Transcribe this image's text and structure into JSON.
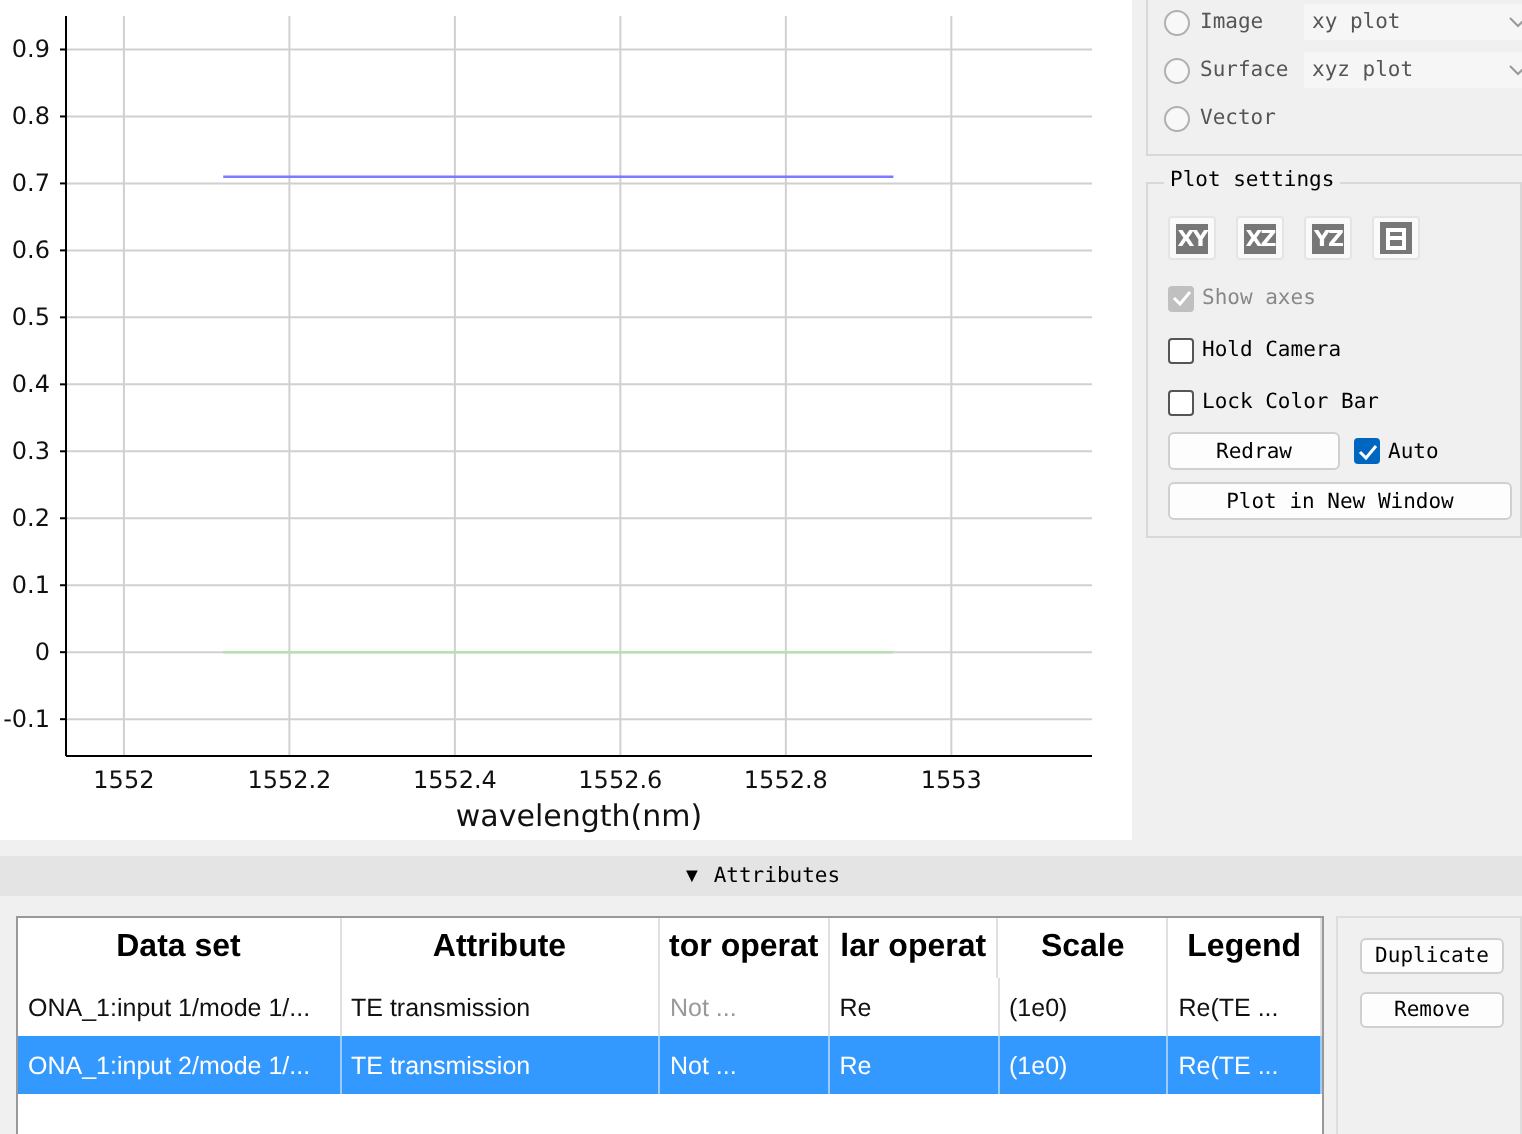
{
  "plot": {
    "chart_data": {
      "type": "line",
      "xlabel": "wavelength(nm)",
      "xlim": [
        1551.93,
        1553.17
      ],
      "ylim": [
        -0.155,
        0.95
      ],
      "xticks": [
        1552,
        {
          "value": 1552.2,
          "label": "1552.2"
        },
        {
          "value": 1552.4,
          "label": "1552.4"
        },
        {
          "value": 1552.6,
          "label": "1552.6"
        },
        {
          "value": 1552.8,
          "label": "1552.8"
        },
        1553
      ],
      "yticks": [
        {
          "value": -0.1,
          "label": "-0.1"
        },
        0,
        {
          "value": 0.1,
          "label": "0.1"
        },
        {
          "value": 0.2,
          "label": "0.2"
        },
        {
          "value": 0.3,
          "label": "0.3"
        },
        {
          "value": 0.4,
          "label": "0.4"
        },
        {
          "value": 0.5,
          "label": "0.5"
        },
        {
          "value": 0.6,
          "label": "0.6"
        },
        {
          "value": 0.7,
          "label": "0.7"
        },
        {
          "value": 0.8,
          "label": "0.8"
        },
        {
          "value": 0.9,
          "label": "0.9"
        }
      ],
      "x": [
        1552.12,
        1552.93
      ],
      "grid": true,
      "series": [
        {
          "color": "#7b7bff",
          "values": [
            0.71,
            0.71
          ]
        },
        {
          "color": "#b8e0b0",
          "values": [
            0,
            0
          ]
        }
      ]
    }
  },
  "plot_types": [
    {
      "label": "Image",
      "selected": false,
      "dropdown": "xy plot"
    },
    {
      "label": "Surface",
      "selected": false,
      "dropdown": "xyz plot"
    },
    {
      "label": "Vector",
      "selected": false
    }
  ],
  "plot_settings": {
    "title": "Plot settings",
    "view_buttons": [
      {
        "kind": "text",
        "label": "XY"
      },
      {
        "kind": "text",
        "label": "XZ"
      },
      {
        "kind": "text",
        "label": "YZ"
      },
      {
        "kind": "lock"
      }
    ],
    "options": [
      {
        "label": "Show axes",
        "checked": true,
        "disabled": true
      },
      {
        "label": "Hold Camera",
        "checked": false,
        "disabled": false
      },
      {
        "label": "Lock Color Bar",
        "checked": false,
        "disabled": false
      }
    ],
    "redraw_button": "Redraw",
    "auto": {
      "label": "Auto",
      "checked": true
    },
    "new_window_button": "Plot in New Window"
  },
  "attributes": {
    "toggle": "▼",
    "title": "Attributes",
    "columns": [
      "Data set",
      "Attribute",
      "tor operat",
      "lar operat",
      "Scale",
      "Legend"
    ],
    "rows": [
      {
        "selected": false,
        "cells": [
          {
            "text": "ONA_1:input 1/mode 1/...",
            "disabled": false
          },
          {
            "text": "TE transmission",
            "disabled": false
          },
          {
            "text": "Not ...",
            "disabled": true
          },
          {
            "text": "Re",
            "disabled": false
          },
          {
            "text": "(1e0)",
            "disabled": false
          },
          {
            "text": "Re(TE ...",
            "disabled": false
          }
        ]
      },
      {
        "selected": true,
        "cells": [
          {
            "text": "ONA_1:input 2/mode 1/...",
            "disabled": false
          },
          {
            "text": "TE transmission",
            "disabled": false
          },
          {
            "text": "Not ...",
            "disabled": false
          },
          {
            "text": "Re",
            "disabled": false
          },
          {
            "text": "(1e0)",
            "disabled": false
          },
          {
            "text": "Re(TE ...",
            "disabled": false
          }
        ]
      }
    ],
    "buttons": [
      "Duplicate",
      "Remove"
    ]
  }
}
